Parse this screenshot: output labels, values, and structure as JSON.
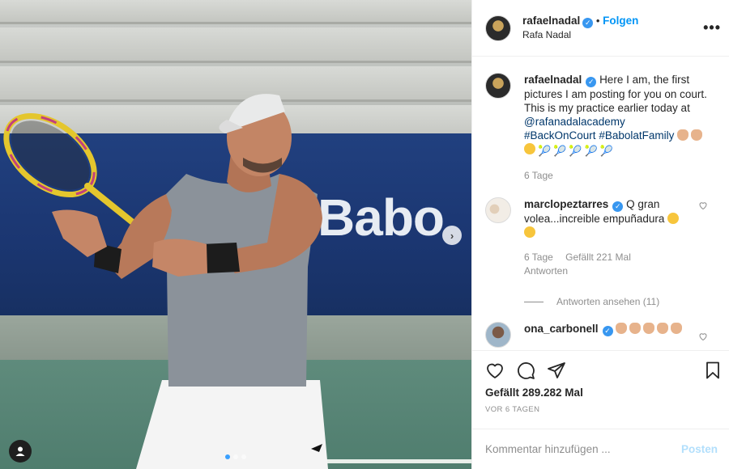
{
  "photo": {
    "banner_text": "Babo",
    "slide_count": 3,
    "active_slide": 1,
    "next_icon": "chevron-right-icon",
    "user_tag_icon": "user-tag-icon"
  },
  "header": {
    "username": "rafaelnadal",
    "separator": "•",
    "follow_label": "Folgen",
    "display_name": "Rafa Nadal",
    "more_icon": "more-options-icon",
    "more_label": "•••"
  },
  "caption": {
    "username": "rafaelnadal",
    "text_line1": "Here I am, the first pictures I am posting for you on court.",
    "text_line2": "This is my practice earlier today at",
    "mention": "@rafanadalacademy",
    "hashtag1": "#BackOnCourt",
    "hashtag2": "#BabolatFamily",
    "time": "6 Tage"
  },
  "comments": [
    {
      "username": "marclopeztarres",
      "text": "Q gran volea...increible empuñadura",
      "time": "6 Tage",
      "likes": "Gefällt 221 Mal",
      "reply_label": "Antworten",
      "view_replies": "Antworten ansehen (11)"
    },
    {
      "username": "ona_carbonell"
    }
  ],
  "actions": {
    "likes": "Gefällt 289.282 Mal",
    "timestamp": "VOR 6 TAGEN"
  },
  "add_comment": {
    "placeholder": "Kommentar hinzufügen ...",
    "post_label": "Posten"
  },
  "colors": {
    "link_blue": "#0095f6",
    "verified_blue": "#3897f0",
    "hashtag": "#00376b",
    "muted": "#8e8e8e",
    "post_disabled": "#b2dffc"
  }
}
